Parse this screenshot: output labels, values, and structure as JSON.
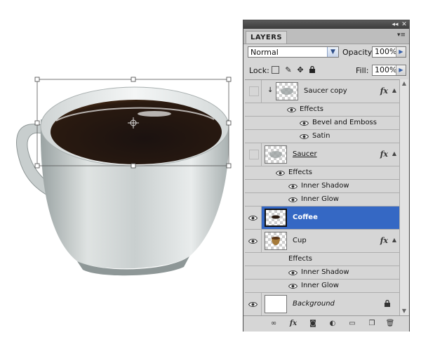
{
  "panel": {
    "tab_label": "LAYERS",
    "titlebar_icons": [
      "collapse-icon",
      "close-icon"
    ],
    "menu_icon": "panel-menu-icon",
    "blend_mode": "Normal",
    "opacity_label": "Opacity:",
    "opacity_value": "100%",
    "lock_label": "Lock:",
    "lock_icons": [
      "lock-transparent-icon",
      "lock-brush-icon",
      "lock-move-icon",
      "lock-all-icon"
    ],
    "fill_label": "Fill:",
    "fill_value": "100%"
  },
  "layers": [
    {
      "name": "Saucer copy",
      "visible": false,
      "has_fx": true,
      "linked_arrow": true,
      "effects_label": "Effects",
      "effects": [
        "Bevel and Emboss",
        "Satin"
      ]
    },
    {
      "name": "Saucer",
      "visible": false,
      "has_fx": true,
      "effects_label": "Effects",
      "effects": [
        "Inner Shadow",
        "Inner Glow"
      ]
    },
    {
      "name": "Coffee",
      "visible": true,
      "selected": true,
      "has_fx": false
    },
    {
      "name": "Cup",
      "visible": true,
      "has_fx": true,
      "effects_label": "Effects",
      "effects": [
        "Inner Shadow",
        "Inner Glow"
      ]
    },
    {
      "name": "Background",
      "visible": true,
      "locked": true
    }
  ],
  "fx_label": "fx",
  "bottom_icons": [
    "link-layers-icon",
    "fx-icon",
    "add-mask-icon",
    "adjustment-layer-icon",
    "new-group-icon",
    "new-layer-icon",
    "trash-icon"
  ],
  "colors": {
    "selection": "#3568c4",
    "panel_bg": "#d6d6d6",
    "coffee": "#2a1a10"
  }
}
